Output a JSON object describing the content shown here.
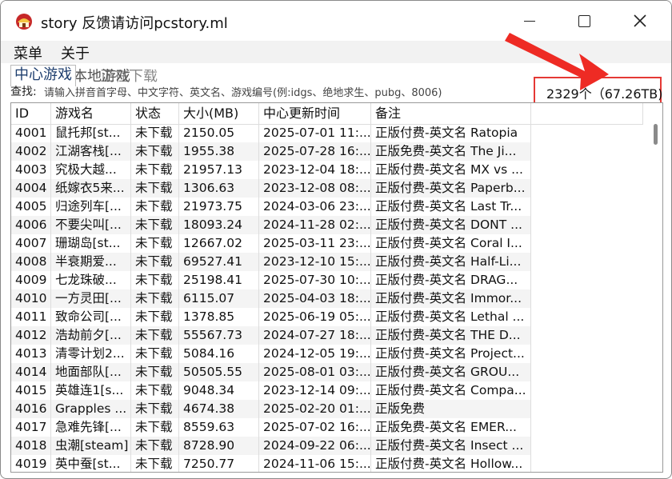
{
  "window": {
    "title": "story 反馈请访问pcstory.ml",
    "controls": {
      "minimize": "—",
      "maximize": "☐",
      "close": "✕"
    }
  },
  "menu": [
    "菜单",
    "关于"
  ],
  "tabs": [
    "中心游戏",
    "本地游戏",
    "正在下载"
  ],
  "search": {
    "label": "查找:",
    "placeholder": "请输入拼音首字母、中文字符、英文名、游戏编号(例:idgs、绝地求生、pubg、8006)"
  },
  "count": "2329个（67.26TB)",
  "colors": {
    "highlight": "#e53935",
    "accent_tab": "#1e3e6e"
  },
  "table": {
    "columns": [
      "ID",
      "游戏名",
      "状态",
      "大小(MB)",
      "中心更新时间",
      "备注",
      ""
    ],
    "rows": [
      [
        "4001",
        "鼠托邦[st...",
        "未下载",
        "2150.05",
        "2025-07-01 11:...",
        "正版付费-英文名 Ratopia"
      ],
      [
        "4002",
        "江湖客栈[...",
        "未下载",
        "1955.38",
        "2025-07-28 16:...",
        "正版免费-英文名 The Ji..."
      ],
      [
        "4003",
        "究极大越...",
        "未下载",
        "21957.13",
        "2023-12-04 18:...",
        "正版付费-英文名 MX vs ..."
      ],
      [
        "4004",
        "纸嫁衣5来...",
        "未下载",
        "1306.63",
        "2023-12-08 08:...",
        "正版付费-英文名 Paperb..."
      ],
      [
        "4005",
        "归途列车[...",
        "未下载",
        "21973.75",
        "2024-03-06 23:...",
        "正版付费-英文名 Last Tr..."
      ],
      [
        "4006",
        "不要尖叫[...",
        "未下载",
        "18093.24",
        "2024-11-28 02:...",
        "正版付费-英文名 DONT ..."
      ],
      [
        "4007",
        "珊瑚岛[st...",
        "未下载",
        "12667.02",
        "2025-03-11 23:...",
        "正版付费-英文名 Coral I..."
      ],
      [
        "4008",
        "半衰期爱...",
        "未下载",
        "69527.41",
        "2023-12-10 15:...",
        "正版付费-英文名 Half-Li..."
      ],
      [
        "4009",
        "七龙珠破...",
        "未下载",
        "25198.41",
        "2025-07-30 10:...",
        "正版付费-英文名 DRAG..."
      ],
      [
        "4010",
        "一方灵田[...",
        "未下载",
        "6115.07",
        "2025-04-03 18:...",
        "正版付费-英文名 Immor..."
      ],
      [
        "4011",
        "致命公司[...",
        "未下载",
        "1378.85",
        "2025-06-19 05:...",
        "正版付费-英文名 Lethal ..."
      ],
      [
        "4012",
        "浩劫前夕[...",
        "未下载",
        "55567.73",
        "2024-07-27 18:...",
        "正版付费-英文名 THE D..."
      ],
      [
        "4013",
        "清零计划2...",
        "未下载",
        "5084.16",
        "2024-12-05 19:...",
        "正版付费-英文名 Project..."
      ],
      [
        "4014",
        "地面部队[...",
        "未下载",
        "50505.55",
        "2025-08-01 03:...",
        "正版付费-英文名 GROU..."
      ],
      [
        "4015",
        "英雄连1[s...",
        "未下载",
        "9048.34",
        "2023-12-14 09:...",
        "正版付费-英文名 Compa..."
      ],
      [
        "4016",
        "Grapples ...",
        "未下载",
        "4674.38",
        "2025-02-20 01:...",
        "正版免费"
      ],
      [
        "4017",
        "急难先锋[...",
        "未下载",
        "8559.63",
        "2025-07-02 16:...",
        "正版免费-英文名 EMER..."
      ],
      [
        "4018",
        "虫潮[steam]",
        "未下载",
        "8728.90",
        "2024-09-22 06:...",
        "正版付费-英文名 Insect ..."
      ],
      [
        "4019",
        "英中蚕[st...",
        "未下载",
        "7250.77",
        "2024-11-06 15:...",
        "正版付费-英文名 Hollow..."
      ]
    ]
  }
}
